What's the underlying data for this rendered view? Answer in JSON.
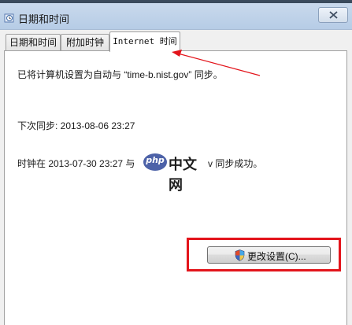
{
  "window": {
    "title": "日期和时间"
  },
  "tabs": [
    {
      "label": "日期和时间",
      "active": false
    },
    {
      "label": "附加时钟",
      "active": false
    },
    {
      "label": "Internet 时间",
      "active": true
    }
  ],
  "content": {
    "sync_setting": "已将计算机设置为自动与 “time-b.nist.gov” 同步。",
    "next_sync": "下次同步: 2013-08-06 23:27",
    "last_sync_prefix": "时钟在 2013-07-30 23:27 与",
    "last_sync_suffix": "v 同步成功。"
  },
  "buttons": {
    "change_settings": "更改设置(C)..."
  },
  "watermark": {
    "logo_text": "php",
    "site_text": "中文网"
  },
  "colors": {
    "annotation_red": "#e3141b",
    "titlebar": "#c9d9ec"
  }
}
